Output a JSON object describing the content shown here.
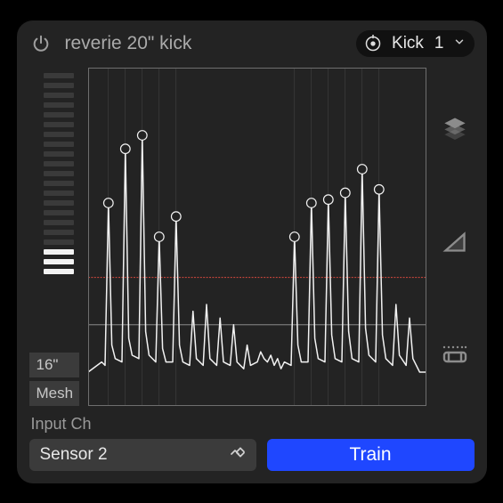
{
  "header": {
    "title": "reverie 20\" kick",
    "drum_type": "Kick",
    "drum_num": "1"
  },
  "meter": {
    "total_segments": 21,
    "lit_from_bottom": 3
  },
  "tags": {
    "size": "16\"",
    "material": "Mesh"
  },
  "chart_data": {
    "type": "line",
    "xlim": [
      0,
      100
    ],
    "ylim": [
      0,
      100
    ],
    "threshold_y": 38,
    "gridlines_x": [
      6,
      11,
      16,
      21,
      26,
      61,
      66,
      71,
      76,
      81,
      86
    ],
    "peaks": [
      {
        "x": 6,
        "y": 60
      },
      {
        "x": 11,
        "y": 76
      },
      {
        "x": 16,
        "y": 80
      },
      {
        "x": 21,
        "y": 50
      },
      {
        "x": 26,
        "y": 56
      },
      {
        "x": 61,
        "y": 50
      },
      {
        "x": 66,
        "y": 60
      },
      {
        "x": 71,
        "y": 61
      },
      {
        "x": 76,
        "y": 63
      },
      {
        "x": 81,
        "y": 70
      },
      {
        "x": 86,
        "y": 64
      }
    ],
    "waveform_points": [
      [
        0,
        10
      ],
      [
        4,
        13
      ],
      [
        5,
        12
      ],
      [
        6,
        60
      ],
      [
        7,
        18
      ],
      [
        8,
        14
      ],
      [
        10,
        13
      ],
      [
        11,
        76
      ],
      [
        12,
        20
      ],
      [
        13,
        15
      ],
      [
        15,
        14
      ],
      [
        16,
        80
      ],
      [
        17,
        22
      ],
      [
        18,
        15
      ],
      [
        20,
        13
      ],
      [
        21,
        50
      ],
      [
        22,
        17
      ],
      [
        23,
        13
      ],
      [
        25,
        13
      ],
      [
        26,
        56
      ],
      [
        27,
        18
      ],
      [
        28,
        13
      ],
      [
        30,
        12
      ],
      [
        31,
        28
      ],
      [
        32,
        14
      ],
      [
        34,
        12
      ],
      [
        35,
        30
      ],
      [
        36,
        14
      ],
      [
        38,
        12
      ],
      [
        39,
        26
      ],
      [
        40,
        13
      ],
      [
        42,
        12
      ],
      [
        43,
        24
      ],
      [
        44,
        13
      ],
      [
        46,
        11
      ],
      [
        47,
        18
      ],
      [
        48,
        12
      ],
      [
        50,
        13
      ],
      [
        51,
        16
      ],
      [
        52,
        14
      ],
      [
        53,
        13
      ],
      [
        54,
        15
      ],
      [
        55,
        12
      ],
      [
        56,
        14
      ],
      [
        57,
        11
      ],
      [
        58,
        13
      ],
      [
        60,
        12
      ],
      [
        61,
        50
      ],
      [
        62,
        18
      ],
      [
        63,
        13
      ],
      [
        65,
        13
      ],
      [
        66,
        60
      ],
      [
        67,
        20
      ],
      [
        68,
        14
      ],
      [
        70,
        13
      ],
      [
        71,
        61
      ],
      [
        72,
        21
      ],
      [
        73,
        14
      ],
      [
        75,
        13
      ],
      [
        76,
        63
      ],
      [
        77,
        22
      ],
      [
        78,
        14
      ],
      [
        80,
        13
      ],
      [
        81,
        70
      ],
      [
        82,
        23
      ],
      [
        83,
        15
      ],
      [
        85,
        13
      ],
      [
        86,
        64
      ],
      [
        87,
        21
      ],
      [
        88,
        14
      ],
      [
        90,
        12
      ],
      [
        91,
        30
      ],
      [
        92,
        15
      ],
      [
        94,
        12
      ],
      [
        95,
        26
      ],
      [
        96,
        14
      ],
      [
        98,
        10
      ],
      [
        100,
        10
      ]
    ]
  },
  "icons": {
    "layers": "layers-icon",
    "triangle": "ramp-icon",
    "segment": "segment-icon"
  },
  "footer": {
    "label": "Input Ch",
    "select_value": "Sensor 2",
    "train_label": "Train"
  }
}
